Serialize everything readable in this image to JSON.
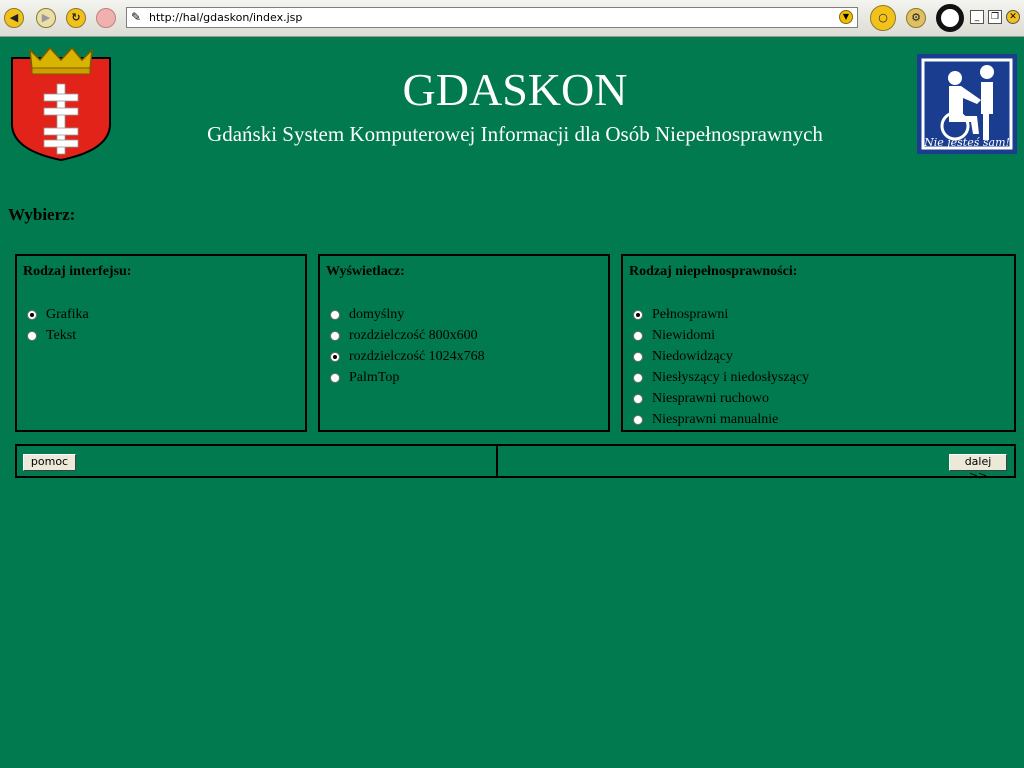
{
  "browser": {
    "url": "http://hal/gdaskon/index.jsp"
  },
  "header": {
    "title": "GDASKON",
    "subtitle": "Gdański System Komputerowej Informacji dla Osób Niepełnosprawnych",
    "logo_text": "Nie jesteś sam!"
  },
  "choose_label": "Wybierz:",
  "sections": {
    "interface": {
      "heading": "Rodzaj interfejsu:",
      "options": [
        "Grafika",
        "Tekst"
      ],
      "selected": "Grafika"
    },
    "display": {
      "heading": "Wyświetlacz:",
      "options": [
        "domyślny",
        "rozdzielczość 800x600",
        "rozdzielczość 1024x768",
        "PalmTop"
      ],
      "selected": "rozdzielczość 1024x768"
    },
    "disability": {
      "heading": "Rodzaj niepełnosprawności:",
      "options": [
        "Pełnosprawni",
        "Niewidomi",
        "Niedowidzący",
        "Niesłyszący i niedosłyszący",
        "Niesprawni ruchowo",
        "Niesprawni manualnie"
      ],
      "selected": "Pełnosprawni"
    }
  },
  "buttons": {
    "help": "pomoc",
    "next": "dalej >>"
  },
  "colors": {
    "background": "#007a4e",
    "crest_red": "#e2231a",
    "logo_blue": "#1b3d8f"
  }
}
